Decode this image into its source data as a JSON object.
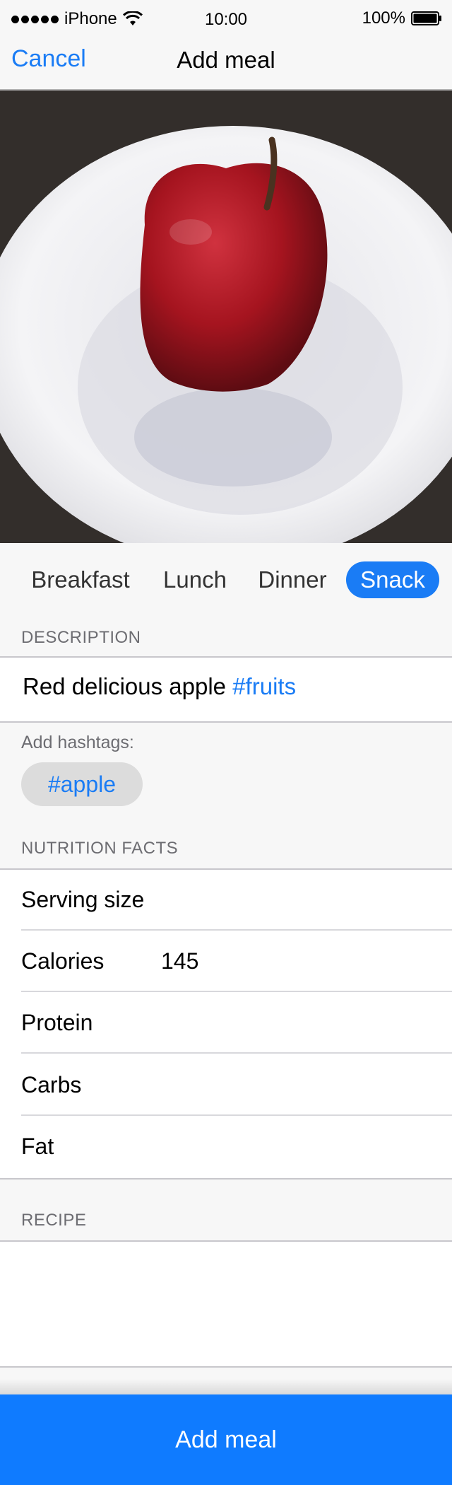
{
  "status_bar": {
    "carrier": "iPhone",
    "time": "10:00",
    "battery": "100%"
  },
  "nav": {
    "cancel_label": "Cancel",
    "title": "Add meal"
  },
  "meal_types": {
    "items": [
      "Breakfast",
      "Lunch",
      "Dinner",
      "Snack"
    ],
    "selected": "Snack"
  },
  "description": {
    "header": "DESCRIPTION",
    "text": "Red delicious apple",
    "hashtag": "#fruits"
  },
  "hashtags": {
    "label": "Add hashtags:",
    "suggestions": [
      "#apple"
    ]
  },
  "nutrition": {
    "header": "NUTRITION FACTS",
    "rows": [
      {
        "label": "Serving size",
        "value": ""
      },
      {
        "label": "Calories",
        "value": "145"
      },
      {
        "label": "Protein",
        "value": ""
      },
      {
        "label": "Carbs",
        "value": ""
      },
      {
        "label": "Fat",
        "value": ""
      }
    ]
  },
  "recipe": {
    "header": "RECIPE",
    "text": ""
  },
  "footer": {
    "add_label": "Add meal"
  },
  "colors": {
    "accent": "#1a7cf5",
    "button": "#0f7bff"
  }
}
